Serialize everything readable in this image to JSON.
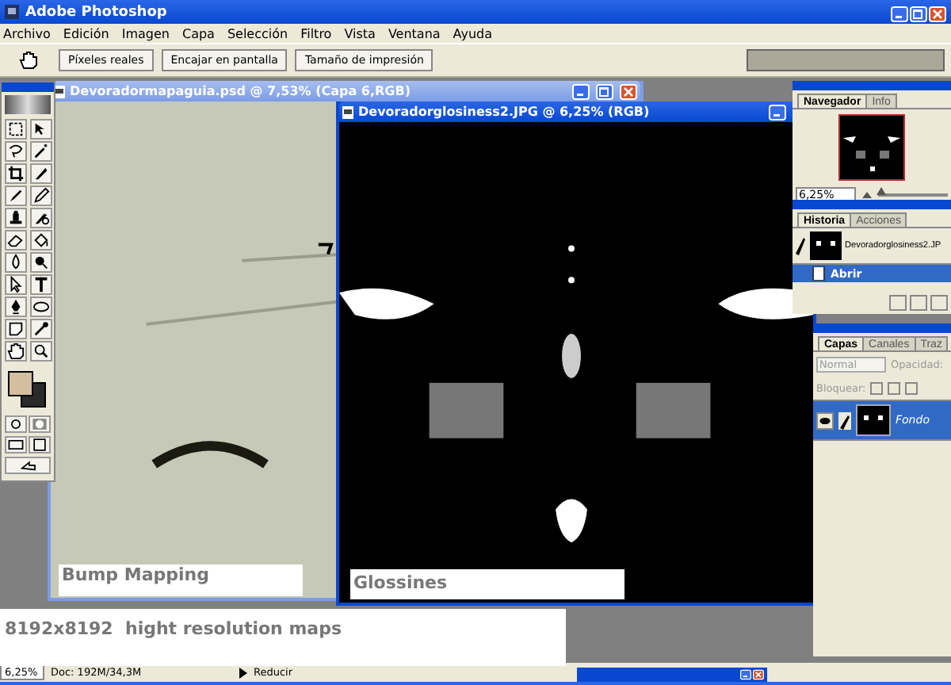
{
  "app": {
    "title": "Adobe Photoshop"
  },
  "menu": [
    {
      "label": "Archivo"
    },
    {
      "label": "Edición"
    },
    {
      "label": "Imagen"
    },
    {
      "label": "Capa"
    },
    {
      "label": "Selección"
    },
    {
      "label": "Filtro"
    },
    {
      "label": "Vista"
    },
    {
      "label": "Ventana"
    },
    {
      "label": "Ayuda"
    }
  ],
  "options_bar": {
    "buttons": [
      "Píxeles reales",
      "Encajar en pantalla",
      "Tamaño de impresión"
    ]
  },
  "documents": [
    {
      "title": "Devoradormapaguia.psd @ 7,53% (Capa 6,RGB)",
      "kind": "bump",
      "active": false
    },
    {
      "title": "Devoradorglosiness2.JPG @ 6,25% (RGB)",
      "kind": "gloss",
      "active": true
    }
  ],
  "navigator": {
    "tabs": [
      {
        "label": "Navegador",
        "selected": true
      },
      {
        "label": "Info",
        "selected": false
      }
    ],
    "zoom": "6,25%",
    "zoom_slider": {
      "level": 0.05
    }
  },
  "history": {
    "tabs": [
      {
        "label": "Historia",
        "selected": true
      },
      {
        "label": "Acciones",
        "selected": false
      }
    ],
    "snapshot": "Devoradorglosiness2.JP",
    "steps": [
      {
        "label": "Abrir",
        "selected": true
      }
    ]
  },
  "layers": {
    "tabs": [
      {
        "label": "Capas",
        "selected": true
      },
      {
        "label": "Canales",
        "selected": false
      },
      {
        "label": "Traz",
        "selected": false
      }
    ],
    "blend_mode": "Normal",
    "opacity_label": "Opacidad:",
    "lock_label": "Bloquear:",
    "items": [
      {
        "name": "Fondo",
        "selected": true,
        "visible": true
      }
    ]
  },
  "overlay_labels": [
    {
      "text": "Bump Mapping",
      "kind": "bump"
    },
    {
      "text": "Glossines",
      "kind": "gloss"
    }
  ],
  "caption": "8192x8192  hight resolution maps",
  "status_bar": {
    "zoom": "6,25%",
    "doc_size": "Doc: 192M/34,3M",
    "tool_hint": "Reducir"
  }
}
